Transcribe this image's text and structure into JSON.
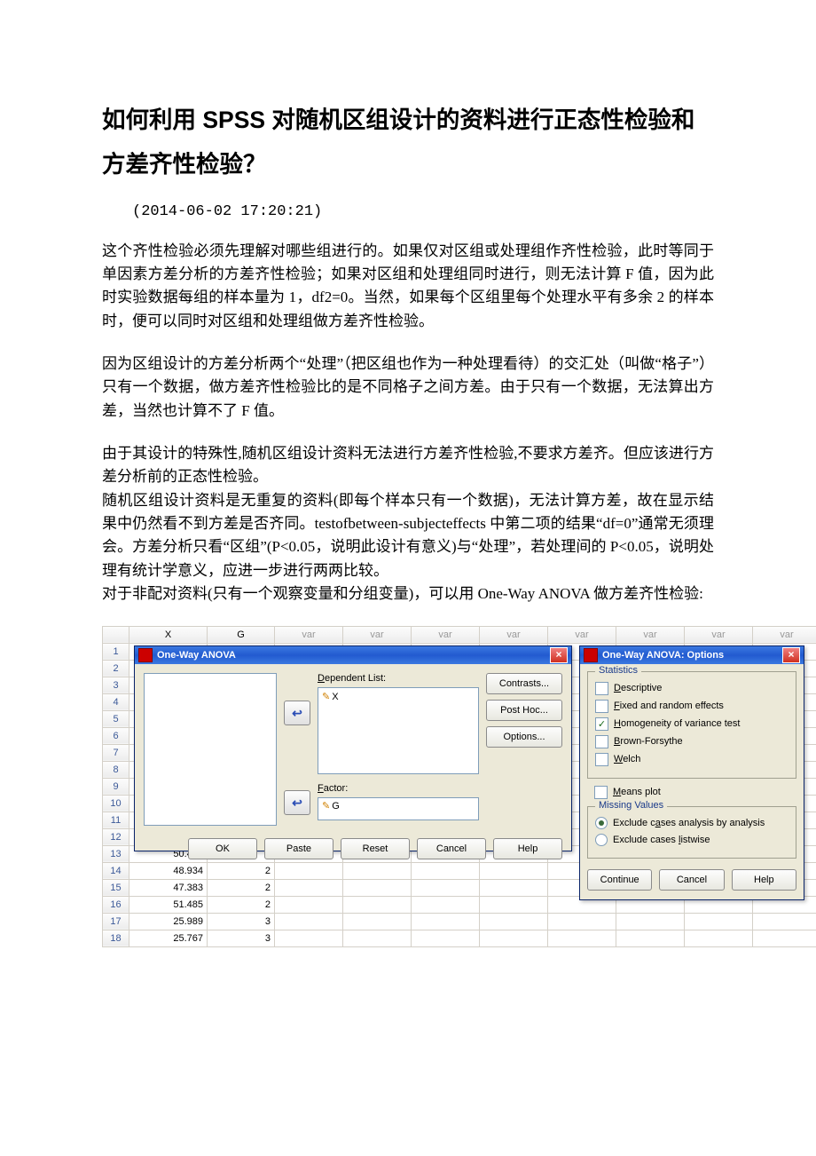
{
  "title": "如何利用 SPSS 对随机区组设计的资料进行正态性检验和方差齐性检验？",
  "timestamp": "(2014-06-02 17:20:21)",
  "p1": "这个齐性检验必须先理解对哪些组进行的。如果仅对区组或处理组作齐性检验，此时等同于单因素方差分析的方差齐性检验；如果对区组和处理组同时进行，则无法计算 F 值，因为此时实验数据每组的样本量为 1，df2=0。当然，如果每个区组里每个处理水平有多余 2 的样本时，便可以同时对区组和处理组做方差齐性检验。",
  "p2": "因为区组设计的方差分析两个“处理”（把区组也作为一种处理看待）的交汇处（叫做“格子”）只有一个数据，做方差齐性检验比的是不同格子之间方差。由于只有一个数据，无法算出方差，当然也计算不了 F 值。",
  "p3a": "由于其设计的特殊性,随机区组设计资料无法进行方差齐性检验,不要求方差齐。但应该进行方差分析前的正态性检验。",
  "p3b": "随机区组设计资料是无重复的资料(即每个样本只有一个数据)，无法计算方差，故在显示结果中仍然看不到方差是否齐同。testofbetween-subjecteffects 中第二项的结果“df=0”通常无须理会。方差分析只看“区组”(P<0.05，说明此设计有意义)与“处理”，若处理间的 P<0.05，说明处理有统计学意义，应进一步进行两两比较。",
  "p3c": "对于非配对资料(只有一个观察变量和分组变量)，可以用 One-Way ANOVA 做方差齐性检验:",
  "sheet": {
    "cols": [
      "X",
      "G",
      "var",
      "var",
      "var",
      "var",
      "var",
      "var",
      "var",
      "var",
      "var"
    ],
    "rows": [
      {
        "n": 1
      },
      {
        "n": 2
      },
      {
        "n": 3
      },
      {
        "n": 4
      },
      {
        "n": 5
      },
      {
        "n": 6
      },
      {
        "n": 7
      },
      {
        "n": 8
      },
      {
        "n": 9
      },
      {
        "n": 10
      },
      {
        "n": 11
      },
      {
        "n": 12
      },
      {
        "n": 13,
        "x": "50.479",
        "g": "2"
      },
      {
        "n": 14,
        "x": "48.934",
        "g": "2"
      },
      {
        "n": 15,
        "x": "47.383",
        "g": "2"
      },
      {
        "n": 16,
        "x": "51.485",
        "g": "2"
      },
      {
        "n": 17,
        "x": "25.989",
        "g": "3"
      },
      {
        "n": 18,
        "x": "25.767",
        "g": "3"
      }
    ]
  },
  "dlgMain": {
    "title": "One-Way ANOVA",
    "depLabel": "Dependent List:",
    "depItem": "X",
    "factorLabel": "Factor:",
    "factorItem": "G",
    "side": {
      "contrasts": "Contrasts...",
      "posthoc": "Post Hoc...",
      "options": "Options..."
    },
    "bottom": {
      "ok": "OK",
      "paste": "Paste",
      "reset": "Reset",
      "cancel": "Cancel",
      "help": "Help"
    }
  },
  "dlgOpt": {
    "title": "One-Way ANOVA: Options",
    "statsLegend": "Statistics",
    "descriptive": "Descriptive",
    "fixed": "Fixed and random effects",
    "homog": "Homogeneity of variance test",
    "brown": "Brown-Forsythe",
    "welch": "Welch",
    "meansplot": "Means plot",
    "missingLegend": "Missing Values",
    "excl1": "Exclude cases analysis by analysis",
    "excl2": "Exclude cases listwise",
    "cont": "Continue",
    "cancel": "Cancel",
    "help": "Help"
  }
}
